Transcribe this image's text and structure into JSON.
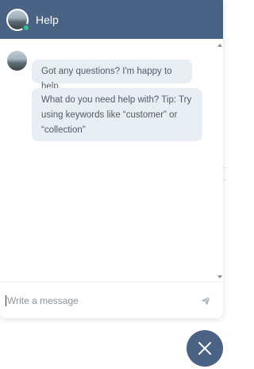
{
  "header": {
    "title": "Help",
    "avatar_icon": "agent-avatar",
    "status_color": "#2fc48f",
    "background_color": "#4a6283"
  },
  "messages": [
    {
      "text": "Got any questions? I'm happy to help."
    },
    {
      "text": "What do you need help with? Tip: Try using keywords like “customer” or “collection”"
    }
  ],
  "composer": {
    "placeholder": "Write a message",
    "send_icon": "send-icon"
  },
  "launcher": {
    "close_icon": "close-icon"
  }
}
